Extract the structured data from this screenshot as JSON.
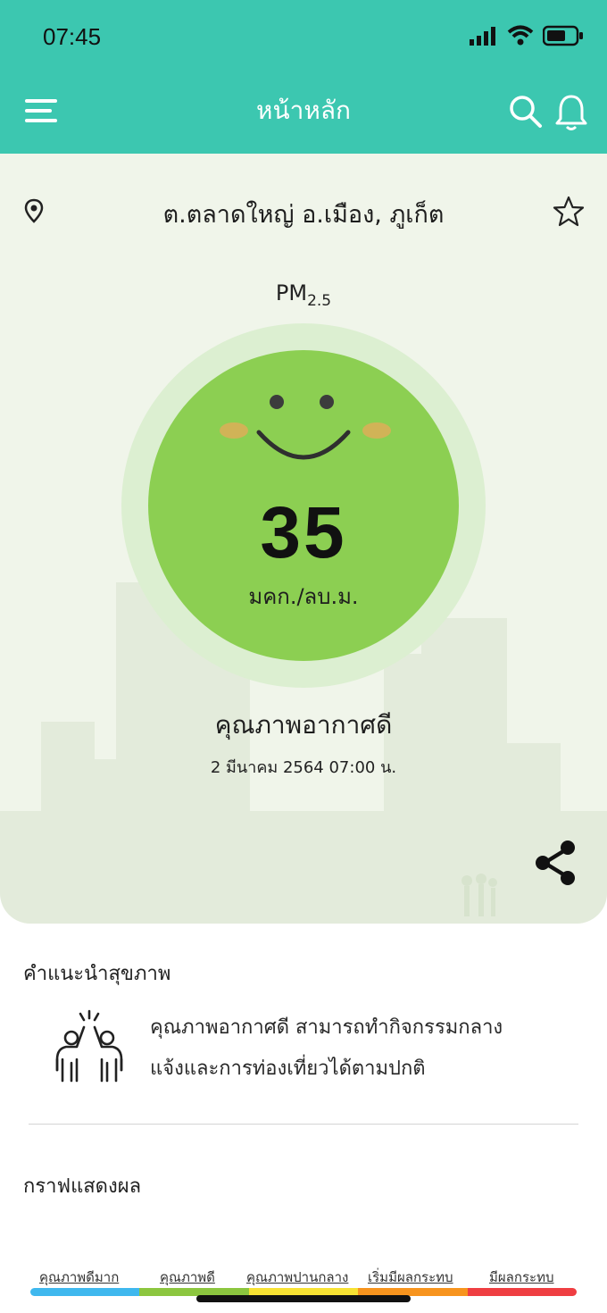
{
  "status_bar": {
    "time": "07:45"
  },
  "header": {
    "title": "หน้าหลัก",
    "menu_icon": "hamburger-menu-icon",
    "search_icon": "search-icon",
    "bell_icon": "bell-icon"
  },
  "location": {
    "name": "ต.ตลาดใหญ่ อ.เมือง, ภูเก็ต",
    "pin_icon": "location-pin-icon",
    "favorite_icon": "star-icon"
  },
  "measurement": {
    "label_main": "PM",
    "label_sub": "2.5",
    "value": "35",
    "unit": "มคก./ลบ.ม.",
    "quality_text": "คุณภาพอากาศดี",
    "datetime": "2 มีนาคม 2564  07:00 น.",
    "face_icon": "smiling-face-icon",
    "circle_color": "#8ccf52"
  },
  "health": {
    "title": "คำแนะนำสุขภาพ",
    "line1": "คุณภาพอากาศดี สามารถทำกิจกรรมกลาง",
    "line2": "แจ้งและการท่องเที่ยวได้ตามปกติ",
    "icon": "people-high-five-icon"
  },
  "graph": {
    "title": "กราฟแสดงผล",
    "legend": [
      {
        "label": "คุณภาพดีมาก",
        "color": "#3fb8ee"
      },
      {
        "label": "คุณภาพดี",
        "color": "#8cc63f"
      },
      {
        "label": "คุณภาพปานกลาง",
        "color": "#f7e233"
      },
      {
        "label": "เริ่มมีผลกระทบ",
        "color": "#f7941e"
      },
      {
        "label": "มีผลกระทบ",
        "color": "#ef3e42"
      }
    ]
  },
  "colors": {
    "header": "#3cc7b0",
    "hero_bg": "#f0f5ea"
  }
}
